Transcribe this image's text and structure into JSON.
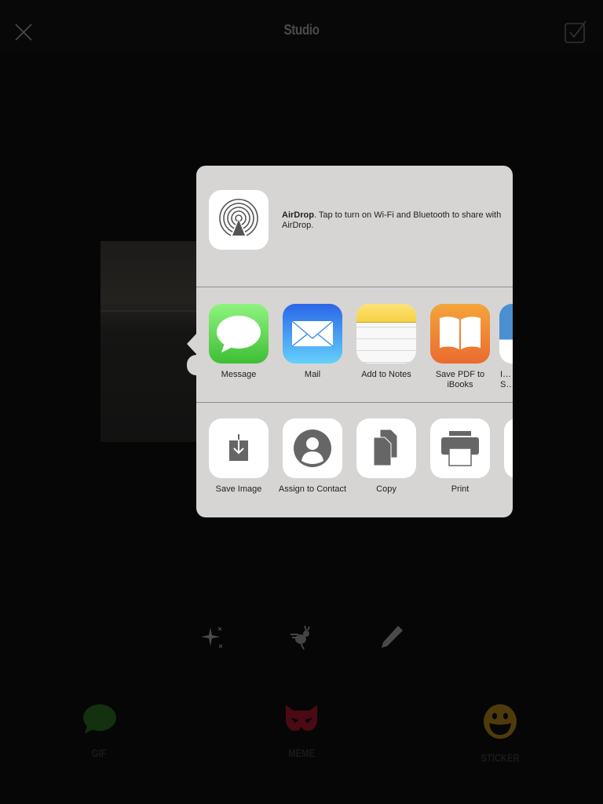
{
  "header": {
    "title": "Studio",
    "close_icon": "close-icon",
    "done_icon": "checkbox-check-icon"
  },
  "share_sheet": {
    "airdrop": {
      "title": "AirDrop",
      "message": ". Tap to turn on Wi-Fi and Bluetooth to share with AirDrop."
    },
    "apps": [
      {
        "label": "Message",
        "icon": "messages-icon"
      },
      {
        "label": "Mail",
        "icon": "mail-icon"
      },
      {
        "label": "Add to Notes",
        "icon": "notes-icon"
      },
      {
        "label": "Save PDF to iBooks",
        "icon": "ibooks-icon"
      },
      {
        "label": "I… S…",
        "icon": "partial-app-icon"
      }
    ],
    "actions": [
      {
        "label": "Save Image",
        "icon": "save-image-icon"
      },
      {
        "label": "Assign to Contact",
        "icon": "contact-icon"
      },
      {
        "label": "Copy",
        "icon": "copy-icon"
      },
      {
        "label": "Print",
        "icon": "print-icon"
      }
    ]
  },
  "tools": [
    "sparkle-icon",
    "rabbit-speed-icon",
    "pencil-icon"
  ],
  "tabs": [
    {
      "label": "GIF",
      "icon": "chat-bubble-icon",
      "color": "#13300f"
    },
    {
      "label": "MEME",
      "icon": "cat-mask-icon",
      "color": "#4a0a14"
    },
    {
      "label": "STICKER",
      "icon": "smiley-icon",
      "color": "#4f3b0a"
    }
  ]
}
